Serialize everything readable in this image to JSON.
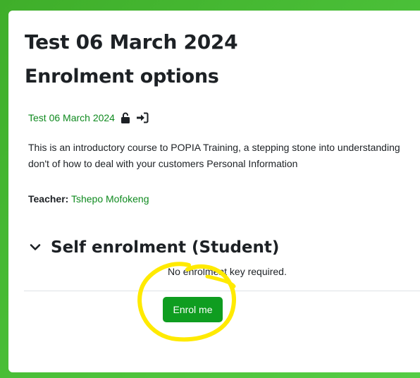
{
  "course": {
    "title": "Test 06 March 2024",
    "link_text": "Test 06 March 2024",
    "summary_line1": "This is an introductory course to POPIA Training, a stepping stone into understanding",
    "summary_line2": "don't of how to deal with your customers Personal Information"
  },
  "page": {
    "title": "Enrolment options"
  },
  "teacher": {
    "label": "Teacher:",
    "name": "Tshepo Mofokeng"
  },
  "enrolment": {
    "section_title": "Self enrolment (Student)",
    "no_key_text": "No enrolment key required.",
    "button_label": "Enrol me"
  },
  "icons": {
    "link_icons": [
      "unlock-icon",
      "enrol-sign-in-icon"
    ],
    "section_toggle": "chevron-down-icon"
  },
  "colors": {
    "background": "#4cc23a",
    "link": "#0f8a1f",
    "button": "#0f9d20",
    "annotation": "#ffea00"
  }
}
